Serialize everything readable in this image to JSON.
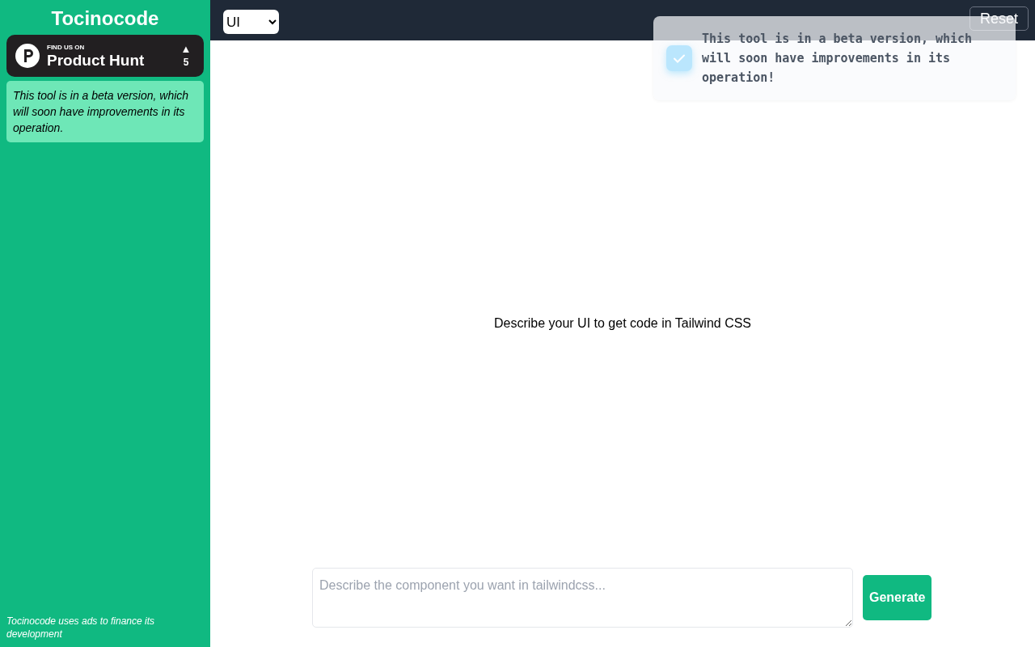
{
  "sidebar": {
    "title": "Tocinocode",
    "product_hunt": {
      "overline": "FIND US ON",
      "name": "Product Hunt",
      "arrow": "▲",
      "votes": "5"
    },
    "beta_note": "This tool is in a beta version, which will soon have improvements in its operation.",
    "footer": "Tocinocode uses ads to finance its development"
  },
  "header": {
    "select": {
      "value": "UI"
    },
    "reset_button": "Reset"
  },
  "toast": {
    "message": "This tool is in a beta version, which will soon have improvements in its operation!"
  },
  "main": {
    "prompt": "Describe your UI to get code in Tailwind CSS"
  },
  "composer": {
    "placeholder": "Describe the component you want in tailwindcss...",
    "button": "Generate"
  }
}
